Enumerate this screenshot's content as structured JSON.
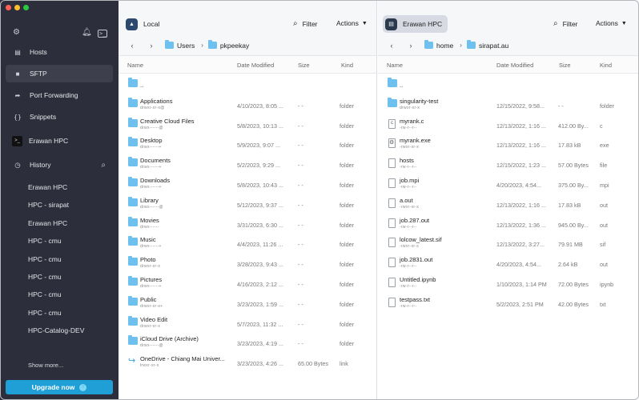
{
  "colors": {
    "sidebar_bg": "#2c2f3b",
    "accent": "#1f9fd6",
    "folder": "#6ec1ef"
  },
  "sidebar": {
    "top_icons": [
      "gear-icon",
      "bell-icon",
      "terminal-icon"
    ],
    "nav": [
      {
        "label": "Hosts",
        "icon": "server-icon"
      },
      {
        "label": "SFTP",
        "icon": "folder-icon",
        "active": true
      },
      {
        "label": "Port Forwarding",
        "icon": "forward-arrow-icon"
      },
      {
        "label": "Snippets",
        "icon": "braces-icon"
      },
      {
        "label": "Erawan HPC",
        "icon": "terminal-badge-icon"
      }
    ],
    "history_label": "History",
    "history": [
      "Erawan HPC",
      "HPC - sirapat",
      "Erawan HPC",
      "HPC - cmu",
      "HPC - cmu",
      "HPC - cmu",
      "HPC - cmu",
      "HPC - cmu",
      "HPC-Catalog-DEV"
    ],
    "show_more": "Show more...",
    "upgrade": "Upgrade now"
  },
  "left": {
    "host": "Local",
    "filter": "Filter",
    "actions": "Actions",
    "path": [
      "Users",
      "pkpeekay"
    ],
    "columns": [
      "Name",
      "Date Modified",
      "Size",
      "Kind"
    ],
    "rows": [
      {
        "name": "..",
        "perm": "",
        "date": "",
        "size": "",
        "kind": "",
        "type": "folder"
      },
      {
        "name": "Applications",
        "perm": "drwxr-xr-x@",
        "date": "4/10/2023, 8:05 ...",
        "size": "- -",
        "kind": "folder",
        "type": "folder"
      },
      {
        "name": "Creative Cloud Files",
        "perm": "drwx------@",
        "date": "5/8/2023, 10:13 ...",
        "size": "- -",
        "kind": "folder",
        "type": "folder"
      },
      {
        "name": "Desktop",
        "perm": "drwx------+",
        "date": "5/9/2023, 9:07 ...",
        "size": "- -",
        "kind": "folder",
        "type": "folder"
      },
      {
        "name": "Documents",
        "perm": "drwx------+",
        "date": "5/2/2023, 9:29 ...",
        "size": "- -",
        "kind": "folder",
        "type": "folder"
      },
      {
        "name": "Downloads",
        "perm": "drwx------+",
        "date": "5/8/2023, 10:43 ...",
        "size": "- -",
        "kind": "folder",
        "type": "folder"
      },
      {
        "name": "Library",
        "perm": "drwx------@",
        "date": "5/12/2023, 9:37 ...",
        "size": "- -",
        "kind": "folder",
        "type": "folder"
      },
      {
        "name": "Movies",
        "perm": "drwx------",
        "date": "3/31/2023, 6:30 ...",
        "size": "- -",
        "kind": "folder",
        "type": "folder"
      },
      {
        "name": "Music",
        "perm": "drwx------+",
        "date": "4/4/2023, 11:26 ...",
        "size": "- -",
        "kind": "folder",
        "type": "folder"
      },
      {
        "name": "Photo",
        "perm": "drwxr-xr-x",
        "date": "3/28/2023, 9:43 ...",
        "size": "- -",
        "kind": "folder",
        "type": "folder"
      },
      {
        "name": "Pictures",
        "perm": "drwx------+",
        "date": "4/16/2023, 2:12 ...",
        "size": "- -",
        "kind": "folder",
        "type": "folder"
      },
      {
        "name": "Public",
        "perm": "drwxr-xr-x+",
        "date": "3/23/2023, 1:59 ...",
        "size": "- -",
        "kind": "folder",
        "type": "folder"
      },
      {
        "name": "Video Edit",
        "perm": "drwxr-xr-x",
        "date": "5/7/2023, 11:32 ...",
        "size": "- -",
        "kind": "folder",
        "type": "folder"
      },
      {
        "name": "iCloud Drive (Archive)",
        "perm": "drwx------@",
        "date": "3/23/2023, 4:19 ...",
        "size": "- -",
        "kind": "folder",
        "type": "folder"
      },
      {
        "name": "OneDrive - Chiang Mai Univer...",
        "perm": "lrwxr-xr-x",
        "date": "3/23/2023, 4:26 ...",
        "size": "65.00 Bytes",
        "kind": "link",
        "type": "link"
      }
    ]
  },
  "right": {
    "host": "Erawan HPC",
    "filter": "Filter",
    "actions": "Actions",
    "path": [
      "home",
      "sirapat.au"
    ],
    "columns": [
      "Name",
      "Date Modified",
      "Size",
      "Kind"
    ],
    "rows": [
      {
        "name": "..",
        "perm": "",
        "date": "",
        "size": "",
        "kind": "",
        "type": "folder"
      },
      {
        "name": "singularity-test",
        "perm": "drwxr-xr-x",
        "date": "12/15/2022, 9:58...",
        "size": "- -",
        "kind": "folder",
        "type": "folder"
      },
      {
        "name": "myrank.c",
        "perm": "-rw-r--r--",
        "date": "12/13/2022, 1:16 ...",
        "size": "412.00 By...",
        "kind": "c",
        "type": "c"
      },
      {
        "name": "myrank.exe",
        "perm": "-rwxr-xr-x",
        "date": "12/13/2022, 1:16 ...",
        "size": "17.83 kB",
        "kind": "exe",
        "type": "exe"
      },
      {
        "name": "hosts",
        "perm": "-rw-r--r--",
        "date": "12/15/2022, 1:23 ...",
        "size": "57.00 Bytes",
        "kind": "file",
        "type": "file"
      },
      {
        "name": "job.mpi",
        "perm": "-rw-r--r--",
        "date": "4/20/2023, 4:54...",
        "size": "375.00 By...",
        "kind": "mpi",
        "type": "file"
      },
      {
        "name": "a.out",
        "perm": "-rwxr-xr-x",
        "date": "12/13/2022, 1:16 ...",
        "size": "17.83 kB",
        "kind": "out",
        "type": "file"
      },
      {
        "name": "job.287.out",
        "perm": "-rw-r--r--",
        "date": "12/13/2022, 1:36 ...",
        "size": "945.00 By...",
        "kind": "out",
        "type": "file"
      },
      {
        "name": "lolcow_latest.sif",
        "perm": "-rwxr-xr-x",
        "date": "12/13/2022, 3:27...",
        "size": "79.91 MB",
        "kind": "sif",
        "type": "file"
      },
      {
        "name": "job.2831.out",
        "perm": "-rw-r--r--",
        "date": "4/20/2023, 4:54...",
        "size": "2.64 kB",
        "kind": "out",
        "type": "file"
      },
      {
        "name": "Untitled.ipynb",
        "perm": "-rw-r--r--",
        "date": "1/10/2023, 1:14 PM",
        "size": "72.00 Bytes",
        "kind": "ipynb",
        "type": "file"
      },
      {
        "name": "testpass.txt",
        "perm": "-rw-r--r--",
        "date": "5/2/2023, 2:51 PM",
        "size": "42.00 Bytes",
        "kind": "txt",
        "type": "file"
      }
    ]
  }
}
